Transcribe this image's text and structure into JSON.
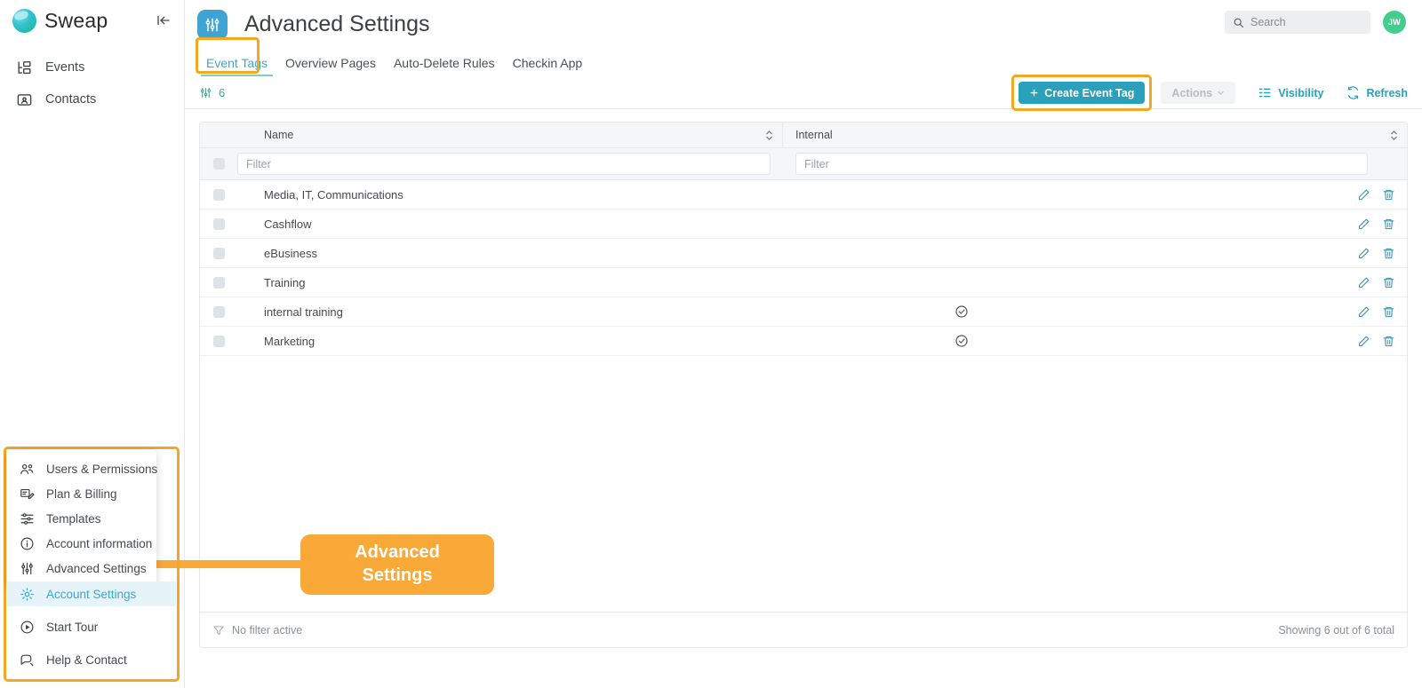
{
  "sidebar": {
    "brand_name": "Sweap",
    "collapse_icon": "collapse-panel-icon",
    "items": [
      {
        "label": "Events",
        "icon": "events-icon"
      },
      {
        "label": "Contacts",
        "icon": "contacts-icon"
      }
    ]
  },
  "header": {
    "title": "Advanced Settings",
    "icon": "sliders-icon",
    "search": {
      "placeholder": "Search",
      "value": "",
      "icon": "search-icon"
    },
    "avatar": {
      "initials": "JW",
      "color": "#45cc8f"
    }
  },
  "tabs": [
    {
      "label": "Event Tags",
      "active": true
    },
    {
      "label": "Overview Pages",
      "active": false
    },
    {
      "label": "Auto-Delete Rules",
      "active": false
    },
    {
      "label": "Checkin App",
      "active": false
    }
  ],
  "count_strip": {
    "icon": "sliders-icon",
    "count": "6"
  },
  "toolbar": {
    "create_label": "Create Event Tag",
    "create_icon": "plus-icon",
    "actions_label": "Actions",
    "actions_caret": "chevron-down-icon",
    "visibility_label": "Visibility",
    "visibility_icon": "columns-visibility-icon",
    "refresh_label": "Refresh",
    "refresh_icon": "refresh-icon"
  },
  "table": {
    "columns": [
      {
        "key": "name",
        "label": "Name",
        "sort_icon": "sort-updown-icon"
      },
      {
        "key": "internal",
        "label": "Internal",
        "sort_icon": "sort-updown-icon"
      }
    ],
    "filters": {
      "name_placeholder": "Filter",
      "name_value": "",
      "internal_placeholder": "Filter",
      "internal_value": ""
    },
    "rows": [
      {
        "name": "Media, IT, Communications",
        "internal": false
      },
      {
        "name": "Cashflow",
        "internal": false
      },
      {
        "name": "eBusiness",
        "internal": false
      },
      {
        "name": "Training",
        "internal": false
      },
      {
        "name": "internal training",
        "internal": true
      },
      {
        "name": "Marketing",
        "internal": true
      }
    ],
    "row_actions": {
      "edit_icon": "pencil-icon",
      "delete_icon": "trash-icon"
    },
    "internal_true_icon": "check-circle-icon"
  },
  "footer": {
    "filter_status": "No filter active",
    "filter_icon": "funnel-icon",
    "showing": "Showing 6 out of 6 total"
  },
  "account_menu": {
    "items": [
      {
        "label": "Users & Permissions",
        "icon": "users-icon"
      },
      {
        "label": "Plan & Billing",
        "icon": "billing-icon"
      },
      {
        "label": "Templates",
        "icon": "templates-icon"
      },
      {
        "label": "Account information",
        "icon": "info-circle-icon"
      },
      {
        "label": "Advanced Settings",
        "icon": "sliders-icon"
      }
    ],
    "lower_items": [
      {
        "label": "Account Settings",
        "icon": "gear-icon",
        "active": true
      },
      {
        "label": "Start Tour",
        "icon": "play-circle-icon",
        "active": false
      },
      {
        "label": "Help & Contact",
        "icon": "chat-help-icon",
        "active": false
      }
    ]
  },
  "callout": {
    "line1": "Advanced",
    "line2": "Settings",
    "color": "#f9a937"
  },
  "highlights": {
    "color": "#f5a623"
  }
}
